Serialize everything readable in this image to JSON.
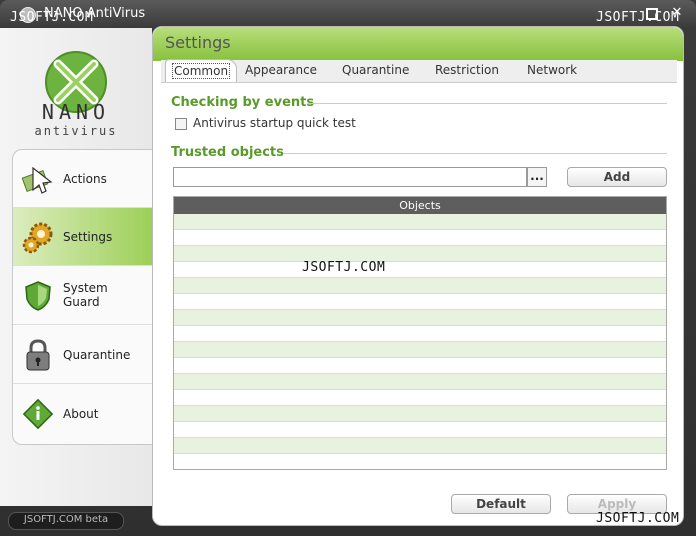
{
  "window": {
    "title": "NANO AntiVirus",
    "watermarks": [
      "JSOFTJ.COM",
      "JSOFTJ.COM",
      "JSOFTJ.COM",
      "JSOFTJ.COM",
      "JSOFTJ.COM"
    ]
  },
  "brand": {
    "name": "NANO",
    "sub": "antivirus",
    "accent": "#87c13d"
  },
  "sidebar": {
    "items": [
      {
        "label": "Actions",
        "icon": "actions-icon"
      },
      {
        "label": "Settings",
        "icon": "gears-icon"
      },
      {
        "label": "System\nGuard",
        "icon": "shield-icon"
      },
      {
        "label": "Quarantine",
        "icon": "padlock-icon"
      },
      {
        "label": "About",
        "icon": "info-icon"
      }
    ],
    "active": "Settings"
  },
  "status": {
    "text": "JSOFTJ.COM beta"
  },
  "panel": {
    "title": "Settings",
    "tabs": [
      "Common",
      "Appearance",
      "Quarantine",
      "Restriction",
      "Network"
    ],
    "active_tab": "Common"
  },
  "common": {
    "checking_title": "Checking by events",
    "startup_check_label": "Antivirus startup quick test",
    "startup_check_checked": false,
    "trusted_title": "Trusted objects",
    "path_value": "",
    "browse_label": "...",
    "add_label": "Add",
    "table_header": "Objects",
    "rows": [
      "",
      "",
      "",
      "",
      "",
      "",
      "",
      "",
      "",
      "",
      "",
      "",
      "",
      "",
      "",
      ""
    ],
    "default_label": "Default",
    "apply_label": "Apply"
  }
}
